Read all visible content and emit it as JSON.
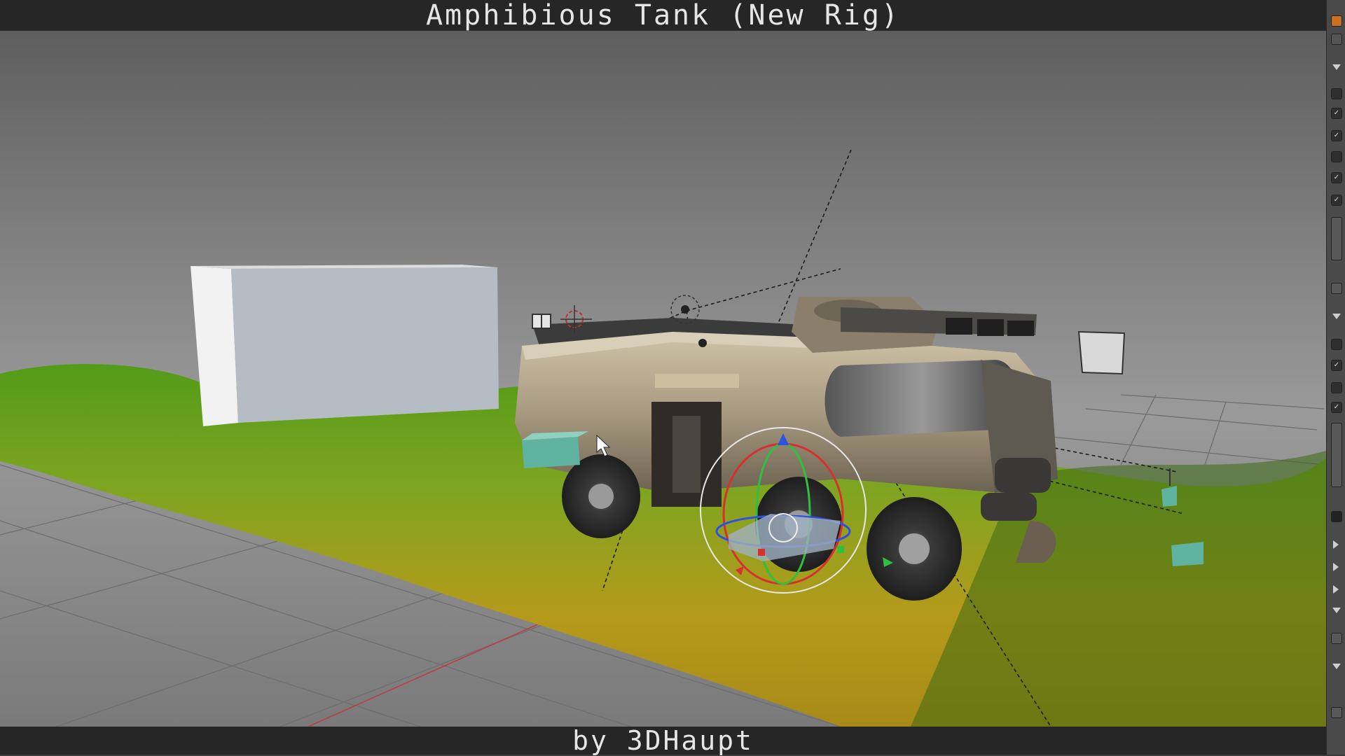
{
  "window": {
    "title": "Amphibious Tank (New Rig)",
    "credit": "by 3DHaupt"
  },
  "viewport": {
    "objects": [
      {
        "name": "wall-block",
        "label": ""
      },
      {
        "name": "amphibious-tank",
        "label": ""
      },
      {
        "name": "terrain",
        "label": ""
      }
    ],
    "colors": {
      "terrain_green": "#6fa020",
      "terrain_yellow": "#b59a1a",
      "tank_body": "#a89a80",
      "tank_dark": "#3a3a3a",
      "controller_teal": "#5fb3a0",
      "gizmo_x": "#d83030",
      "gizmo_y": "#30c040",
      "gizmo_z": "#3050e0"
    }
  },
  "side_panel": {
    "icons": [
      "pin-icon",
      "collapse-arrow-icon",
      "checkbox-icon",
      "checkbox-icon",
      "checkbox-icon",
      "checkbox-icon",
      "checkbox-icon",
      "checkbox-icon"
    ]
  }
}
